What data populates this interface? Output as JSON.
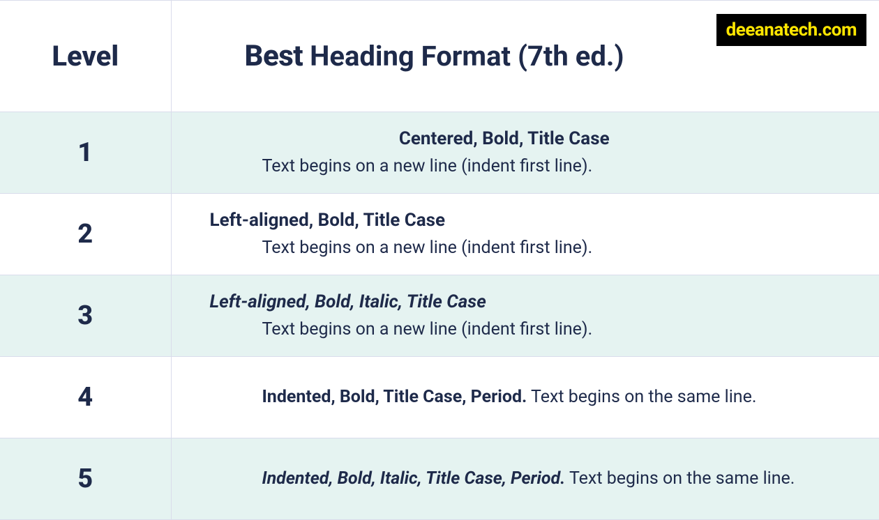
{
  "watermark": "deeanatech.com",
  "header": {
    "level": "Level",
    "format_best": "Best",
    "format_rest": "Heading Format (7th ed.)"
  },
  "rows": [
    {
      "level": "1",
      "line1": "Centered, Bold, Title Case",
      "line2": "Text begins on a new line (indent first line)."
    },
    {
      "level": "2",
      "line1": "Left-aligned, Bold, Title Case",
      "line2": "Text begins on a new line (indent first line)."
    },
    {
      "level": "3",
      "line1": "Left-aligned, Bold, Italic, Title Case",
      "line2": "Text begins on a new line (indent first line)."
    },
    {
      "level": "4",
      "bold": "Indented, Bold, Title Case, Period.",
      "rest": " Text begins on the same line."
    },
    {
      "level": "5",
      "bold": "Indented, Bold, Italic, Title Case, Period.",
      "rest": " Text begins on the same line."
    }
  ]
}
